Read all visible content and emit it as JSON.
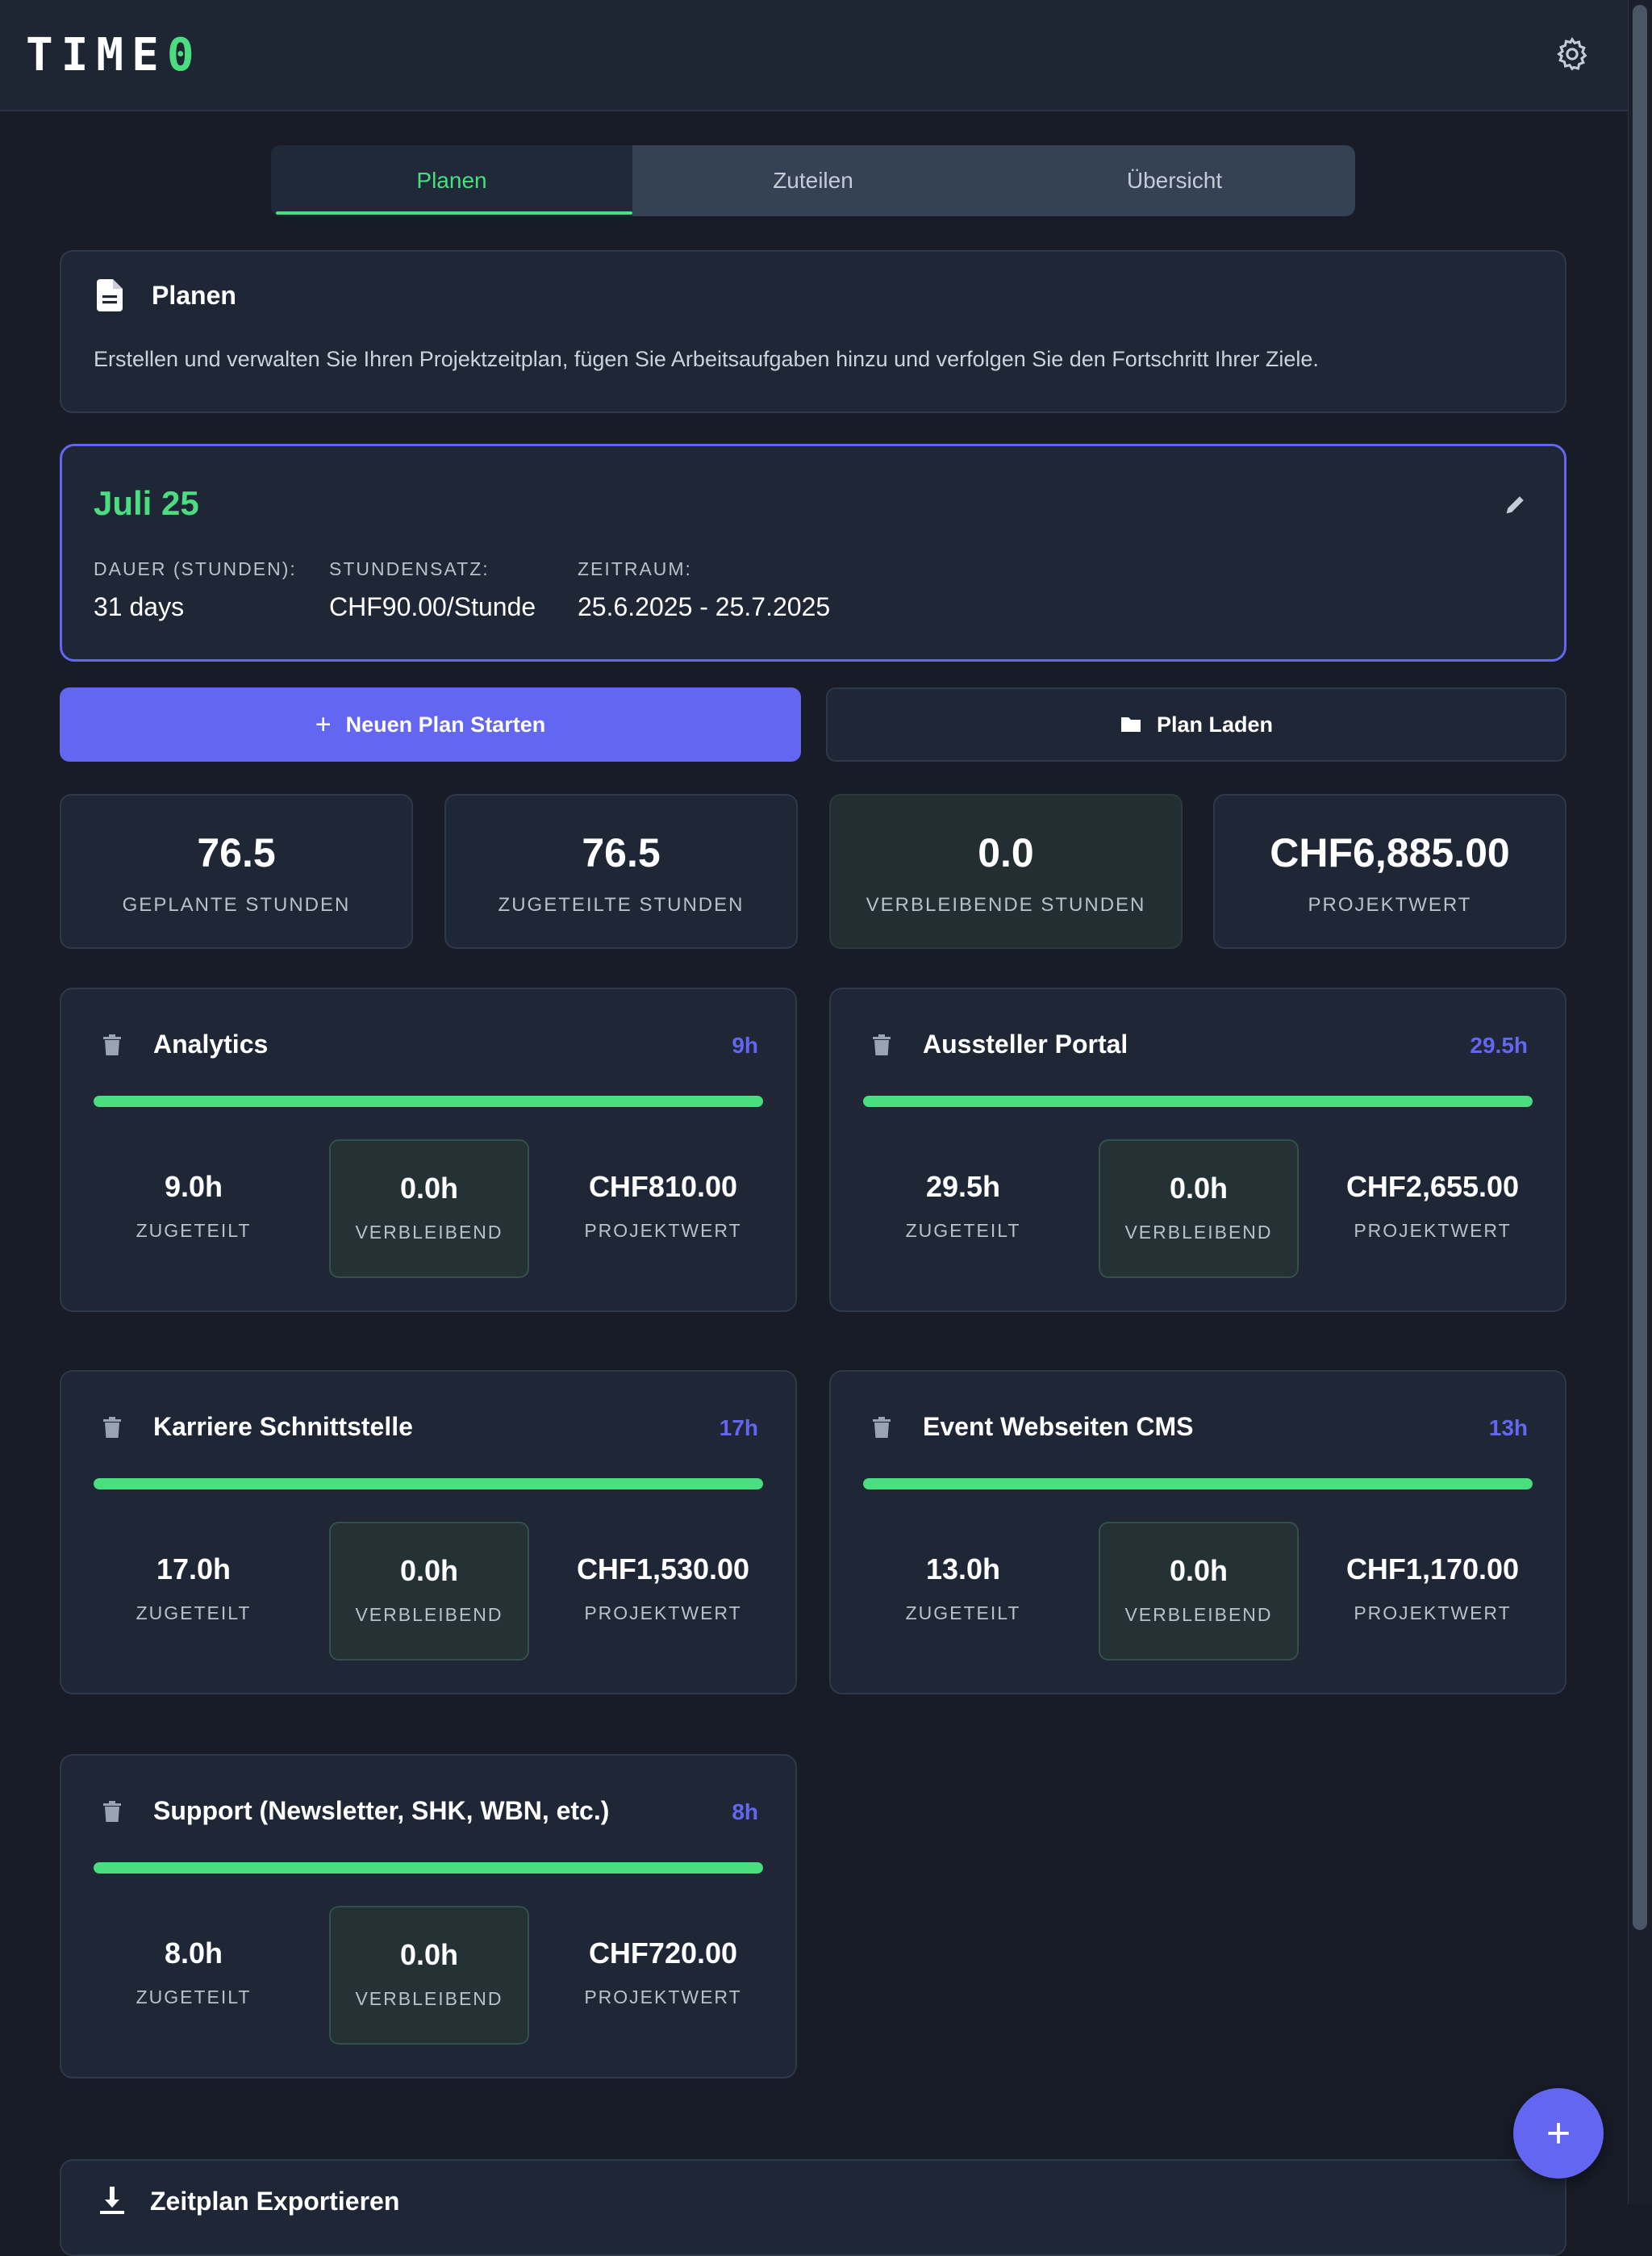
{
  "app": {
    "logo_text": "TIME",
    "logo_accent": "0"
  },
  "tabs": [
    {
      "label": "Planen",
      "active": true
    },
    {
      "label": "Zuteilen",
      "active": false
    },
    {
      "label": "Übersicht",
      "active": false
    }
  ],
  "intro": {
    "title": "Planen",
    "text": "Erstellen und verwalten Sie Ihren Projektzeitplan, fügen Sie Arbeitsaufgaben hinzu und verfolgen Sie den Fortschritt Ihrer Ziele."
  },
  "plan": {
    "title": "Juli 25",
    "duration_label": "DAUER (STUNDEN):",
    "duration_value": "31 days",
    "rate_label": "STUNDENSATZ:",
    "rate_value": "CHF90.00/Stunde",
    "period_label": "ZEITRAUM:",
    "period_value": "25.6.2025 - 25.7.2025"
  },
  "actions": {
    "new_plan": "Neuen Plan Starten",
    "load_plan": "Plan Laden",
    "fab": "+"
  },
  "stats": [
    {
      "value": "76.5",
      "label": "GEPLANTE STUNDEN"
    },
    {
      "value": "76.5",
      "label": "ZUGETEILTE STUNDEN"
    },
    {
      "value": "0.0",
      "label": "VERBLEIBENDE STUNDEN"
    },
    {
      "value": "CHF6,885.00",
      "label": "PROJEKTWERT"
    }
  ],
  "captions": {
    "allocated": "ZUGETEILT",
    "remaining": "VERBLEIBEND",
    "value": "PROJEKTWERT"
  },
  "projects": [
    {
      "name": "Analytics",
      "hours": "9h",
      "allocated": "9.0h",
      "remaining": "0.0h",
      "value": "CHF810.00",
      "progress": 1.0
    },
    {
      "name": "Aussteller Portal",
      "hours": "29.5h",
      "allocated": "29.5h",
      "remaining": "0.0h",
      "value": "CHF2,655.00",
      "progress": 1.0
    },
    {
      "name": "Karriere Schnittstelle",
      "hours": "17h",
      "allocated": "17.0h",
      "remaining": "0.0h",
      "value": "CHF1,530.00",
      "progress": 1.0
    },
    {
      "name": "Event Webseiten CMS",
      "hours": "13h",
      "allocated": "13.0h",
      "remaining": "0.0h",
      "value": "CHF1,170.00",
      "progress": 1.0
    },
    {
      "name": "Support (Newsletter, SHK, WBN, etc.)",
      "hours": "8h",
      "allocated": "8.0h",
      "remaining": "0.0h",
      "value": "CHF720.00",
      "progress": 1.0
    }
  ],
  "export": {
    "title": "Zeitplan Exportieren"
  },
  "colors": {
    "accent": "#6366f1",
    "success": "#4ade80",
    "background": "#171c27",
    "card": "#1f2737"
  }
}
